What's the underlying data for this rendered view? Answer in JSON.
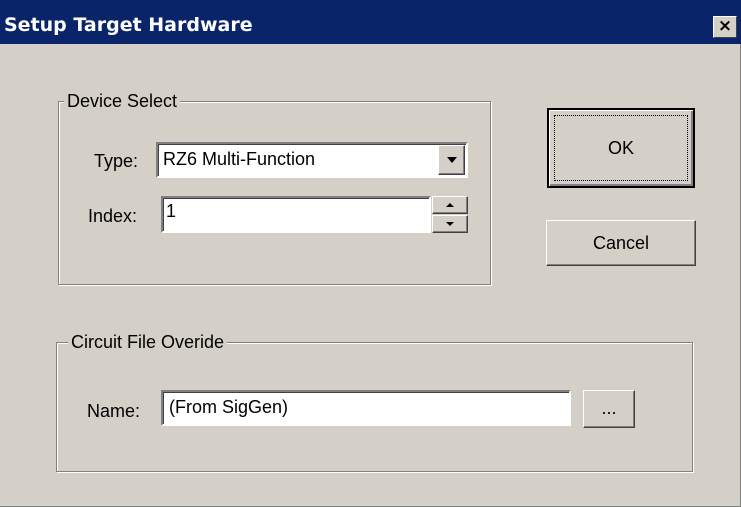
{
  "window": {
    "title": "Setup Target Hardware",
    "close_glyph": "×"
  },
  "device_select": {
    "legend": "Device Select",
    "type_label": "Type:",
    "type_value": "RZ6  Multi-Function",
    "index_label": "Index:",
    "index_value": "1"
  },
  "circuit_file": {
    "legend": "Circuit File Overide",
    "name_label": "Name:",
    "name_value": "(From SigGen)",
    "browse_label": "..."
  },
  "buttons": {
    "ok": "OK",
    "cancel": "Cancel"
  },
  "colors": {
    "title_bar": "#0a246a",
    "dialog_face": "#d4d0c8"
  },
  "icons": {
    "dropdown": "chevron-down-icon",
    "spin_up": "spin-up-icon",
    "spin_down": "spin-down-icon",
    "close": "close-icon"
  }
}
